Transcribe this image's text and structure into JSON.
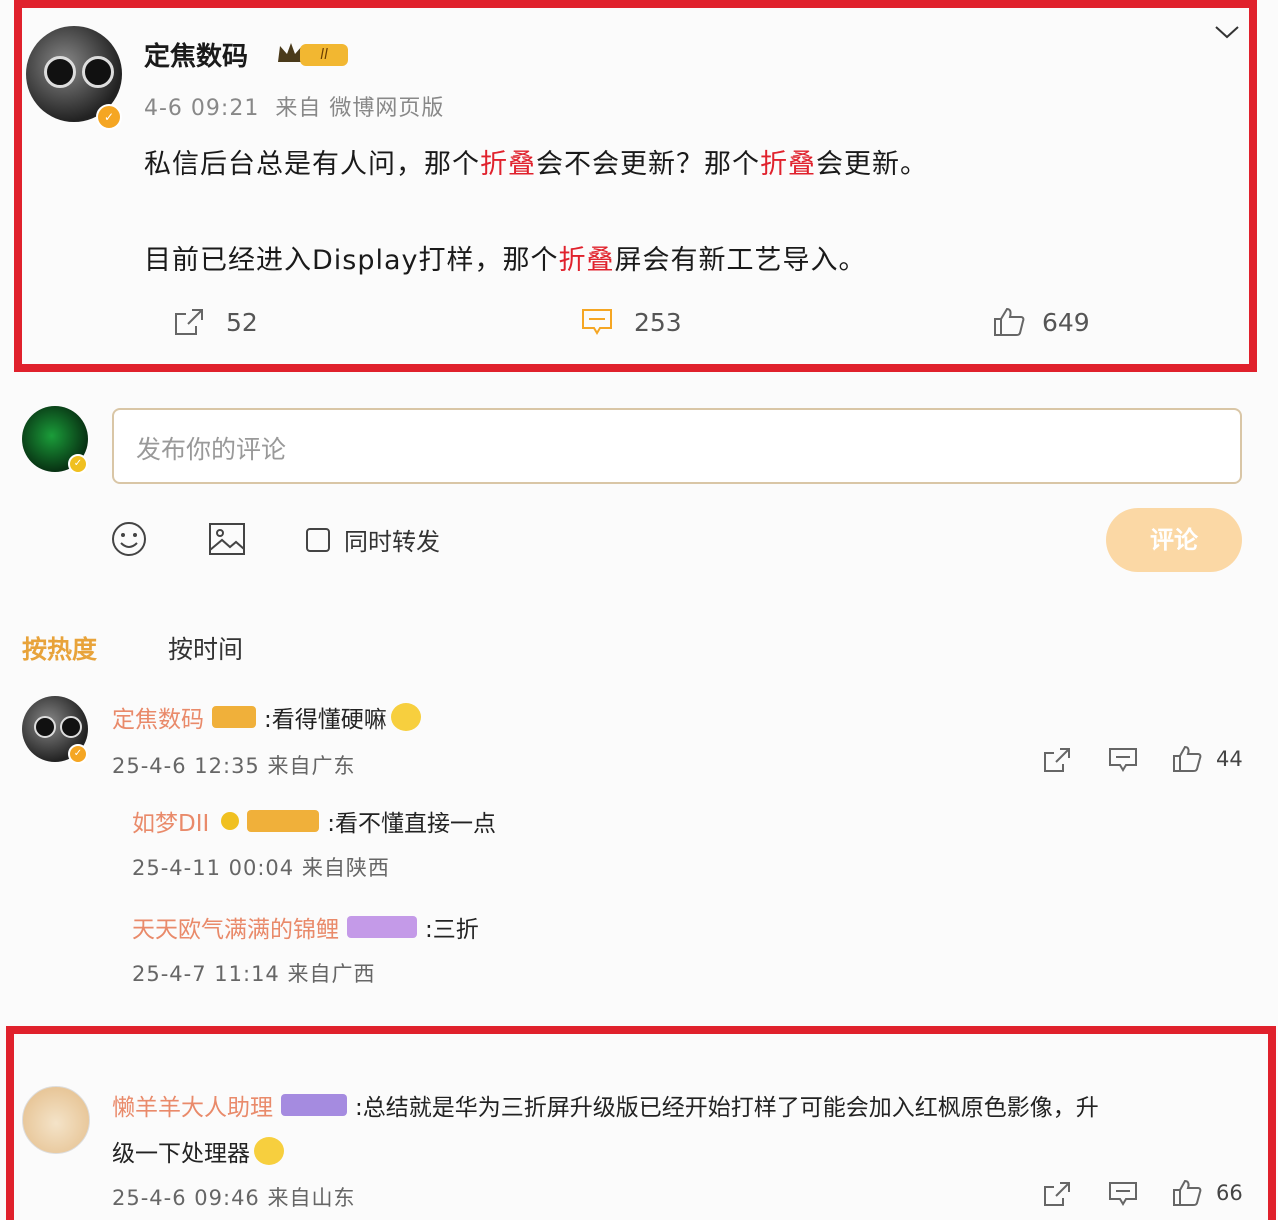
{
  "post": {
    "author": "定焦数码",
    "level_badge": "ll",
    "time": "4-6 09:21",
    "source": "来自 微博网页版",
    "line1_parts": [
      "私信后台总是有人问，那个",
      "折叠",
      "会不会更新？那个",
      "折叠",
      "会更新。"
    ],
    "line2_parts": [
      "目前已经进入Display打样，那个",
      "折叠",
      "屏会有新工艺导入。"
    ],
    "shares": "52",
    "comments": "253",
    "likes": "649"
  },
  "composer": {
    "placeholder": "发布你的评论",
    "repost_label": "同时转发",
    "submit_label": "评论"
  },
  "sort_tabs": {
    "hot": "按热度",
    "time": "按时间"
  },
  "comments": [
    {
      "author": "定焦数码",
      "text": ":看得懂硬嘛",
      "meta": "25-4-6 12:35 来自广东",
      "likes": "44",
      "replies": [
        {
          "author": "如梦DII",
          "text": ":看不懂直接一点",
          "meta": "25-4-11 00:04 来自陕西"
        },
        {
          "author": "天天欧气满满的锦鲤",
          "text": ":三折",
          "meta": "25-4-7 11:14 来自广西"
        }
      ]
    },
    {
      "author": "懒羊羊大人助理",
      "text_line1": ":总结就是华为三折屏升级版已经开始打样了可能会加入红枫原色影像，升",
      "text_line2": "级一下处理器",
      "meta": "25-4-6 09:46 来自山东",
      "likes": "66"
    }
  ],
  "colors": {
    "highlight_border": "#e0212c",
    "accent": "#f5a623",
    "username": "#e98a6a"
  }
}
